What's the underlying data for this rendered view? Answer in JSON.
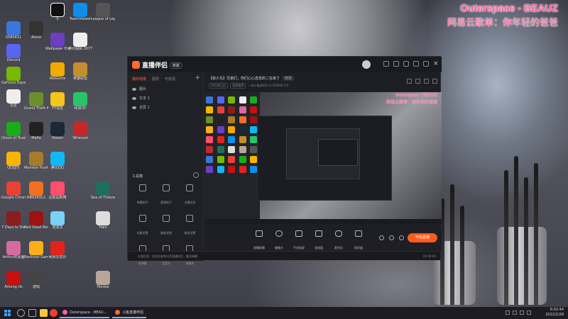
{
  "overlay": {
    "song_title": "Outerspace - BEAUZ",
    "song_subtitle": "网易云歌单：你年轻的爸爸"
  },
  "desktop_icons": [
    "5560411",
    "Discord",
    "GeForce Experience",
    "恋爱",
    "Ghost of Tsushima",
    "QQ音乐",
    "Google Chrome",
    "7 Days to Die",
    "Arthur的桌面",
    "Among Us",
    "Alone",
    "Grand Theft Auto V",
    "Mafia",
    "Monster Hunter",
    "NBA2K0L2",
    "Red Dead Redemption",
    "Rockstar Games",
    "游戏",
    "S",
    "Wallpaper Engine",
    "WeGame",
    "YY语音",
    "Steam",
    "腾讯QQ",
    "这就是街舞",
    "泡泡龙",
    "网易云音乐",
    "TeamViewer",
    "腾讯视频 2077",
    "英雄联盟",
    "网易UU",
    "Wirecast",
    "League of Legends",
    "Sea of Thieves",
    "Halo",
    "Honkai"
  ],
  "app": {
    "logo_text": "直播伴侣",
    "version_pill": "新版",
    "sidebar_tabs": [
      "我的场景",
      "图层",
      "可能需"
    ],
    "layers": [
      "图片",
      "文本 1",
      "全屏 1"
    ],
    "tools_header": "工具箱",
    "tools": [
      "弹幕助手",
      "管理助手",
      "主播信息",
      "场景设置",
      "美颜滤镜",
      "推流设置",
      "进弹幕",
      "混音台",
      "弹幕秀"
    ],
    "stream_title": "【抢小鸟】兄弟们，你们心心念念的二在来了",
    "edit_label": "修改",
    "stream_meta": [
      "50分享之后",
      "获得推荐",
      "一场小焦虑的2+2",
      "559916",
      "2",
      "0"
    ],
    "preview_overlay_title": "Outerspace - BEAUZ",
    "preview_overlay_subtitle": "网易云歌单：你年轻的爸爸",
    "controls": [
      "直播屏幕",
      "摄像头",
      "手机投屏",
      "游戏窗",
      "麦克风",
      "扬声器"
    ],
    "go_live": "开始直播",
    "status_left": "礼物信息：欢迎你来到抖音直播伴侣，勤进弹幕",
    "status_right": "00:00:00"
  },
  "taskbar": {
    "apps": [
      "Outerspace - BEAU...",
      "斗鱼直播伴侣"
    ],
    "time": "6:02:44",
    "date": "2022/2/28"
  }
}
